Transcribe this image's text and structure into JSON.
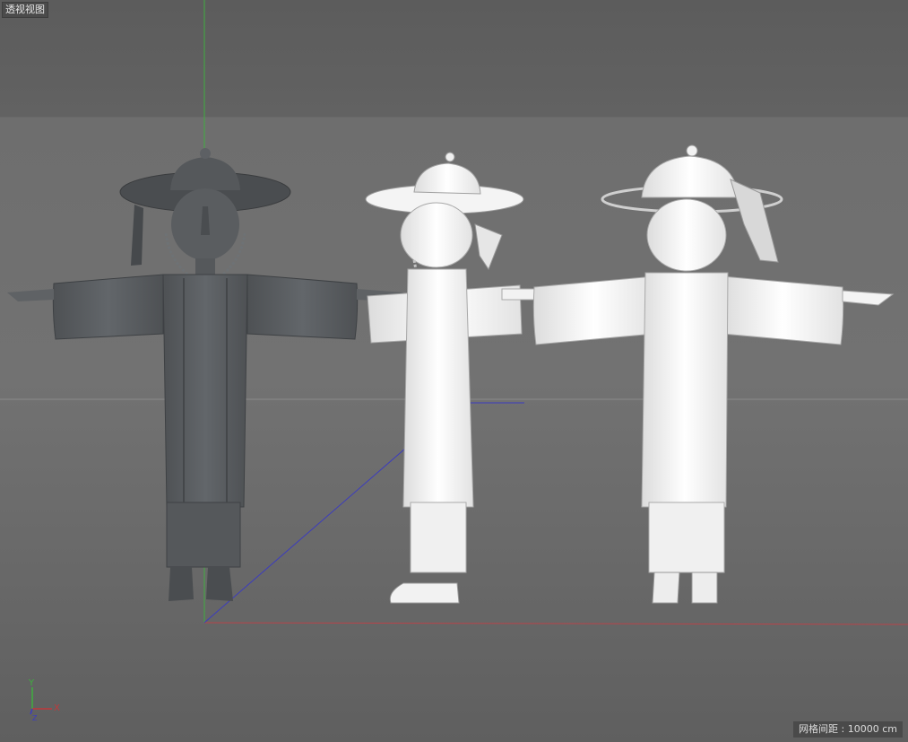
{
  "viewport": {
    "title": "透视视图",
    "grid_spacing_label": "网格间距 : 10000 cm"
  },
  "axis_gizmo": {
    "x": "X",
    "y": "Y",
    "z": "Z"
  },
  "colors": {
    "x_axis": "#c0393b",
    "y_axis": "#3fae3f",
    "z_axis": "#3b3bbf",
    "dark_model": "#5b5e61",
    "light_model": "#f2f2f2"
  },
  "models": [
    {
      "name": "figure-front-dark"
    },
    {
      "name": "figure-side-white"
    },
    {
      "name": "figure-back-white"
    }
  ]
}
